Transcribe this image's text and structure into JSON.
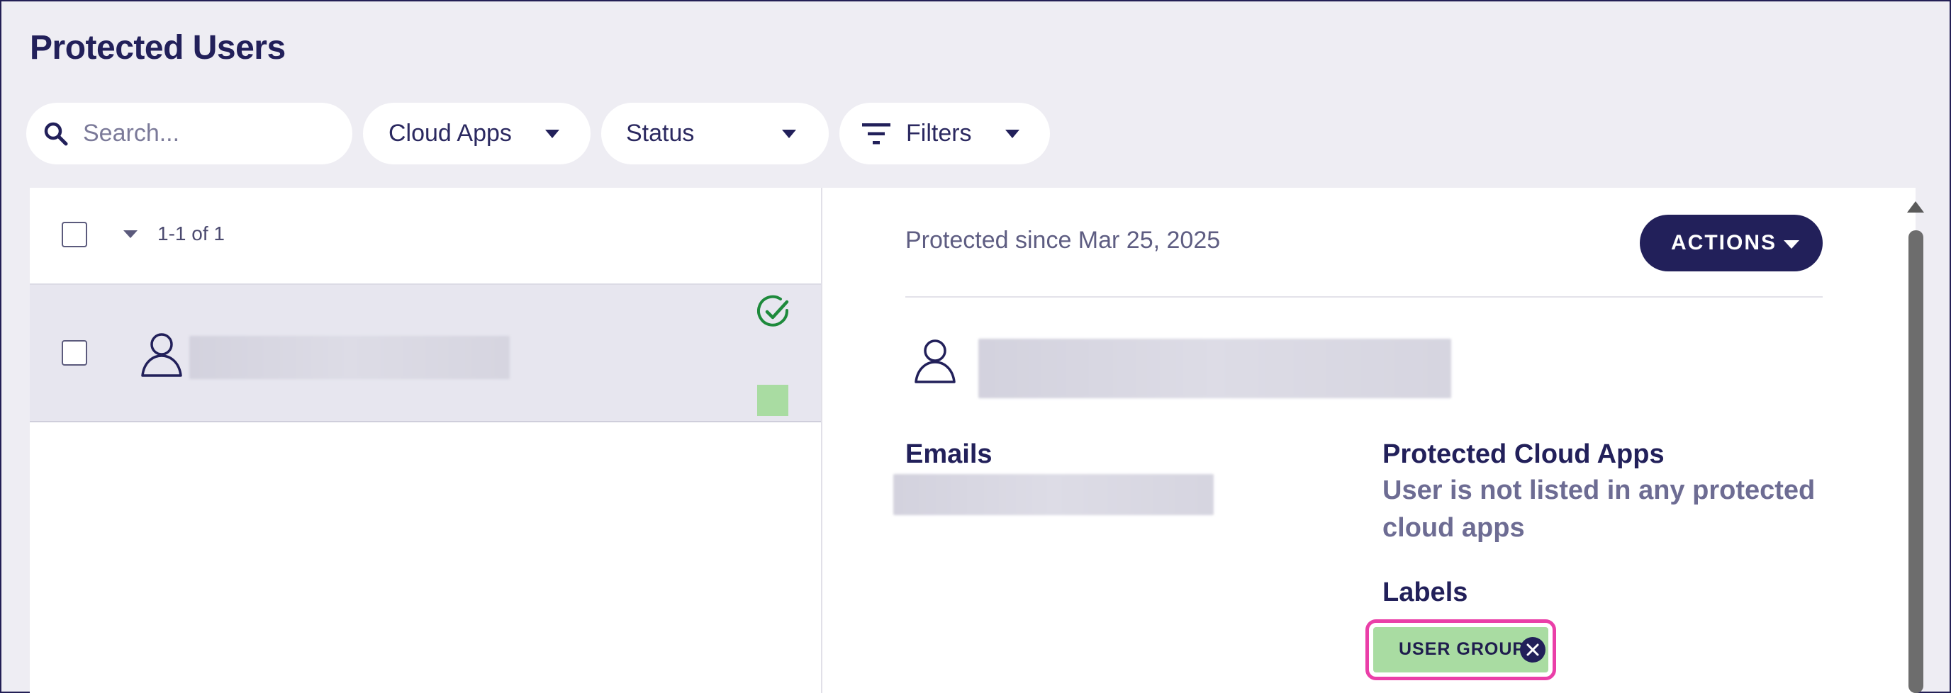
{
  "page": {
    "title": "Protected Users"
  },
  "toolbar": {
    "search_placeholder": "Search...",
    "cloud_apps_label": "Cloud Apps",
    "status_label": "Status",
    "filters_label": "Filters"
  },
  "list": {
    "count_text": "1-1 of 1",
    "rows": [
      {
        "status": "protected",
        "status_icon": "check-circle-icon",
        "swatch_color": "#a9dca2"
      }
    ]
  },
  "detail": {
    "protected_since": "Protected since Mar 25, 2025",
    "actions_label": "ACTIONS",
    "emails_heading": "Emails",
    "protected_cloud_apps_heading": "Protected Cloud Apps",
    "protected_cloud_apps_text": "User is not listed in any protected cloud apps",
    "labels_heading": "Labels",
    "labels": [
      "USER GROUP 1"
    ]
  },
  "colors": {
    "primary": "#22205a",
    "background": "#eeedf3",
    "success": "#1e8a3c",
    "label_green": "#a9dca2",
    "highlight": "#ea3fa8"
  }
}
